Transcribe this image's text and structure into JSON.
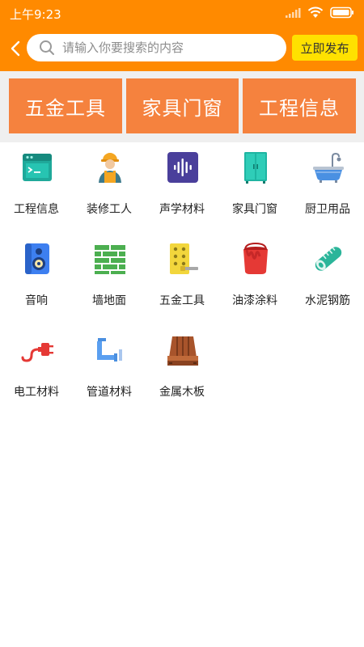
{
  "status_bar": {
    "time": "上午9:23"
  },
  "search": {
    "placeholder": "请输入你要搜索的内容",
    "value": ""
  },
  "nav": {
    "publish_label": "立即发布"
  },
  "banner": [
    {
      "label": "五金工具"
    },
    {
      "label": "家具门窗"
    },
    {
      "label": "工程信息"
    }
  ],
  "categories": [
    {
      "label": "工程信息",
      "icon": "browser-window-icon"
    },
    {
      "label": "装修工人",
      "icon": "worker-icon"
    },
    {
      "label": "声学材料",
      "icon": "sound-wave-icon"
    },
    {
      "label": "家具门窗",
      "icon": "wardrobe-icon"
    },
    {
      "label": "厨卫用品",
      "icon": "bathtub-icon"
    },
    {
      "label": "音响",
      "icon": "speaker-icon"
    },
    {
      "label": "墙地面",
      "icon": "brick-wall-icon"
    },
    {
      "label": "五金工具",
      "icon": "hardware-panel-icon"
    },
    {
      "label": "油漆涂料",
      "icon": "paint-bucket-icon"
    },
    {
      "label": "水泥钢筋",
      "icon": "ruler-tube-icon"
    },
    {
      "label": "电工材料",
      "icon": "power-plug-icon"
    },
    {
      "label": "管道材料",
      "icon": "pipe-icon"
    },
    {
      "label": "金属木板",
      "icon": "wood-planks-icon"
    }
  ],
  "colors": {
    "header": "#ff8a00",
    "publish_button": "#ffe100",
    "banner_tile": "#f5823e",
    "banner_background": "#efefef"
  }
}
